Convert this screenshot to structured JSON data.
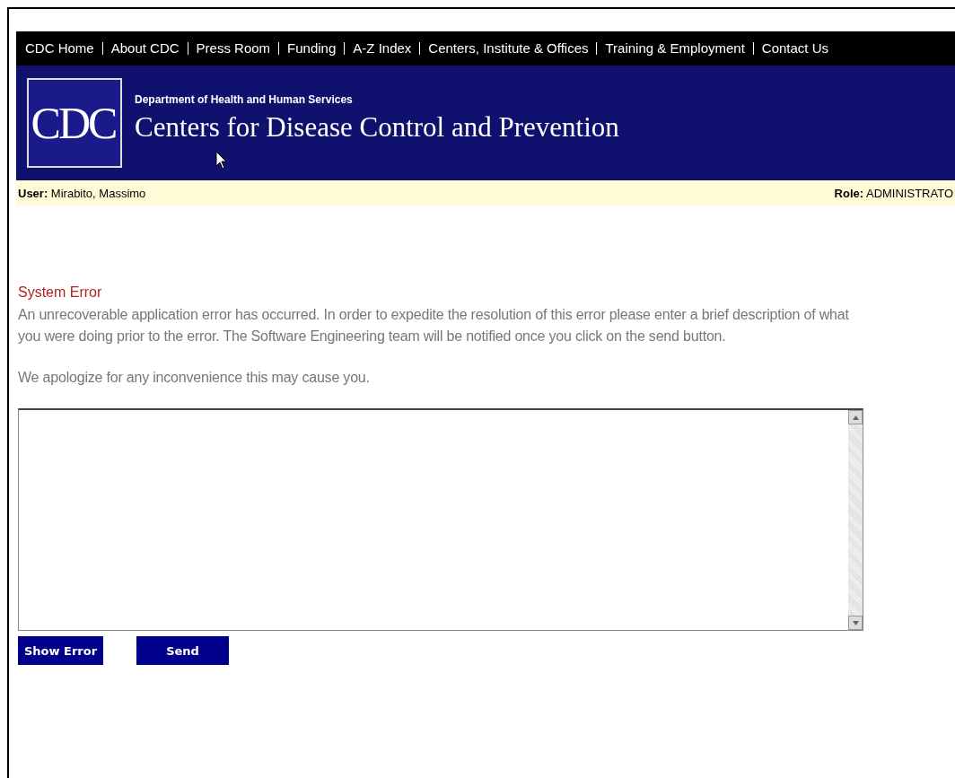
{
  "nav": [
    {
      "label": "CDC Home"
    },
    {
      "label": "About CDC"
    },
    {
      "label": "Press Room"
    },
    {
      "label": "Funding"
    },
    {
      "label": "A-Z Index"
    },
    {
      "label": "Centers, Institute & Offices"
    },
    {
      "label": "Training & Employment"
    },
    {
      "label": "Contact Us"
    }
  ],
  "banner": {
    "logo": "CDC",
    "department": "Department of Health and Human Services",
    "title": "Centers for Disease Control and Prevention"
  },
  "user_bar": {
    "user_label": "User:",
    "user": "Mirabito, Massimo",
    "role_label": "Role:",
    "role": "ADMINISTRATO"
  },
  "error": {
    "heading": "System Error",
    "message": "An unrecoverable application error has occurred. In order to expedite the resolution of this error please enter a brief description of what you were doing prior to the error. The Software Engineering team will be notified once you click on the send button.",
    "apology": "We apologize for any inconvenience this may cause you."
  },
  "buttons": [
    "Show Error",
    "Send"
  ]
}
